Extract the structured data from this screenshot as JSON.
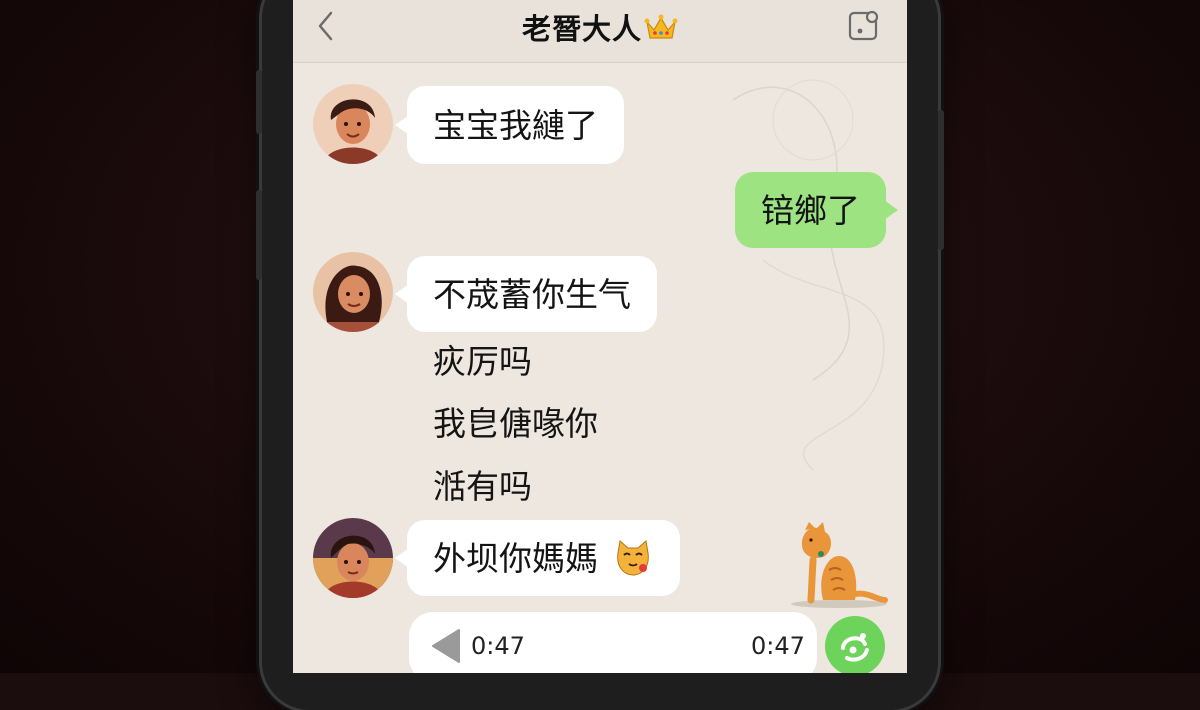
{
  "chat": {
    "title": "老朁大人",
    "title_emoji": "crown-icon",
    "back_icon": "chevron-left-icon",
    "more_icon": "square-dot-icon"
  },
  "messages": [
    {
      "side": "left",
      "text": "宝宝我縺了",
      "avatar": "woman-avatar"
    },
    {
      "side": "right",
      "text": "锫鄉了"
    },
    {
      "side": "left",
      "text": "不荿蓄你生气",
      "avatar": "woman-avatar"
    },
    {
      "side": "left",
      "text": "疢厉吗"
    },
    {
      "side": "left",
      "text": "我皀傏喙你"
    },
    {
      "side": "left",
      "text": "湉有吗"
    },
    {
      "side": "left",
      "text": "外坝你媽媽",
      "emoji": "cat-face-icon",
      "avatar": "woman-avatar"
    }
  ],
  "voice": {
    "elapsed": "0:47",
    "duration": "0:47",
    "play_icon": "play-triangle-icon",
    "action_icon": "green-voice-icon"
  },
  "sticker": "orange-cat-sticker",
  "colors": {
    "screen_bg": "#ede7df",
    "header_bg": "#e8e2da",
    "bubble_left": "#ffffff",
    "bubble_right": "#9de382",
    "action_green": "#6dd35a",
    "backdrop": "#1b0c0d"
  }
}
